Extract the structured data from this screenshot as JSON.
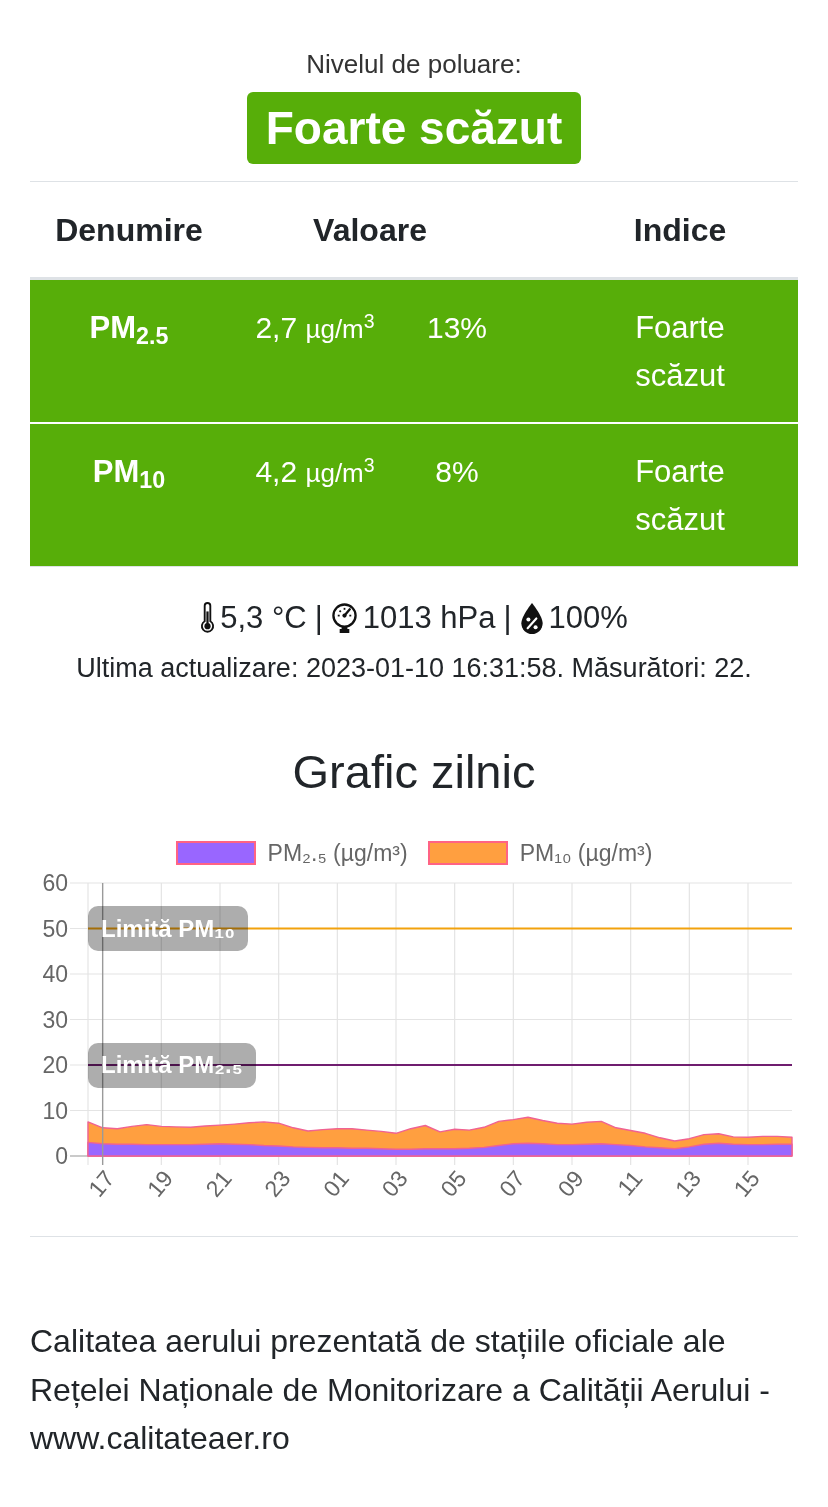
{
  "summary": {
    "label": "Nivelul de poluare:",
    "status": "Foarte scăzut"
  },
  "table": {
    "columns": [
      {
        "label": "Denumire"
      },
      {
        "label": "Valoare"
      },
      {
        "label": "Indice"
      }
    ],
    "rows": [
      {
        "name": "PM$_{2.5}$",
        "value": "2,7",
        "unit": "µg/m$^{3}$",
        "percent": "13%",
        "index": "Foarte scăzut"
      },
      {
        "name": "PM$_{10}$",
        "value": "4,2",
        "unit": "µg/m$^{3}$",
        "percent": "8%",
        "index": "Foarte scăzut"
      }
    ]
  },
  "weather": [
    {
      "kind": "temperature",
      "text": "5,3 °C"
    },
    {
      "kind": "separator",
      "text": "|"
    },
    {
      "kind": "pressure",
      "text": "1013 hPa"
    },
    {
      "kind": "separator",
      "text": "|"
    },
    {
      "kind": "humidity",
      "text": "100%"
    }
  ],
  "update_info": "Ultima actualizare: 2023-01-10 16:31:58. Măsurători: 22.",
  "chart": {
    "chart_data": {
      "type": "area",
      "title": "Grafic zilnic",
      "legend": "top",
      "grid": true,
      "x": [
        "2023-01-09T16:30",
        "2023-01-09T17:00",
        "2023-01-09T17:30",
        "2023-01-09T18:00",
        "2023-01-09T18:30",
        "2023-01-09T19:00",
        "2023-01-09T19:30",
        "2023-01-09T20:00",
        "2023-01-09T20:30",
        "2023-01-09T21:00",
        "2023-01-09T21:30",
        "2023-01-09T22:00",
        "2023-01-09T22:30",
        "2023-01-09T23:00",
        "2023-01-09T23:30",
        "2023-01-10T00:00",
        "2023-01-10T00:30",
        "2023-01-10T01:00",
        "2023-01-10T01:30",
        "2023-01-10T02:00",
        "2023-01-10T02:30",
        "2023-01-10T03:00",
        "2023-01-10T03:30",
        "2023-01-10T04:00",
        "2023-01-10T04:30",
        "2023-01-10T05:00",
        "2023-01-10T05:30",
        "2023-01-10T06:00",
        "2023-01-10T06:30",
        "2023-01-10T07:00",
        "2023-01-10T07:30",
        "2023-01-10T08:00",
        "2023-01-10T08:30",
        "2023-01-10T09:00",
        "2023-01-10T09:30",
        "2023-01-10T10:00",
        "2023-01-10T10:30",
        "2023-01-10T11:00",
        "2023-01-10T11:30",
        "2023-01-10T12:00",
        "2023-01-10T12:30",
        "2023-01-10T13:00",
        "2023-01-10T13:30",
        "2023-01-10T14:00",
        "2023-01-10T14:30",
        "2023-01-10T15:00",
        "2023-01-10T15:30",
        "2023-01-10T16:00",
        "2023-01-10T16:30"
      ],
      "series": [
        {
          "name": "PM₂.₅ (µg/m³)",
          "color": "#9966ff",
          "values": [
            3.0,
            2.7,
            2.6,
            2.6,
            2.5,
            2.5,
            2.5,
            2.5,
            2.6,
            2.7,
            2.6,
            2.5,
            2.3,
            2.2,
            2.0,
            1.9,
            1.8,
            1.8,
            1.7,
            1.7,
            1.6,
            1.5,
            1.5,
            1.6,
            1.6,
            1.6,
            1.7,
            1.9,
            2.3,
            2.7,
            2.8,
            2.7,
            2.5,
            2.5,
            2.6,
            2.7,
            2.5,
            2.3,
            2.0,
            1.8,
            1.6,
            2.0,
            2.6,
            2.8,
            2.6,
            2.5,
            2.5,
            2.6,
            2.6
          ]
        },
        {
          "name": "PM₁₀ (µg/m³)",
          "color": "#ff9f40",
          "values": [
            7.5,
            6.2,
            6.0,
            6.5,
            6.9,
            6.5,
            6.4,
            6.3,
            6.6,
            6.8,
            7.0,
            7.3,
            7.5,
            7.2,
            6.2,
            5.5,
            5.8,
            6.0,
            6.0,
            5.7,
            5.4,
            5.0,
            6.0,
            6.7,
            5.3,
            5.9,
            5.7,
            6.3,
            7.6,
            8.0,
            8.5,
            7.8,
            7.2,
            7.0,
            7.4,
            7.6,
            6.2,
            5.6,
            5.0,
            4.0,
            3.3,
            3.8,
            4.7,
            4.9,
            4.2,
            4.1,
            4.3,
            4.3,
            4.1
          ]
        }
      ],
      "xlim": [
        "2023-01-09T16:30",
        "2023-01-10T16:30"
      ],
      "ylim": [
        0,
        60
      ],
      "yticks": [
        0,
        10,
        20,
        30,
        40,
        50,
        60
      ],
      "xticks": [
        {
          "value": "2023-01-09T17:00",
          "label": "17"
        },
        {
          "value": "2023-01-09T19:00",
          "label": "19"
        },
        {
          "value": "2023-01-09T21:00",
          "label": "21"
        },
        {
          "value": "2023-01-09T23:00",
          "label": "23"
        },
        {
          "value": "2023-01-10T01:00",
          "label": "01"
        },
        {
          "value": "2023-01-10T03:00",
          "label": "03"
        },
        {
          "value": "2023-01-10T05:00",
          "label": "05"
        },
        {
          "value": "2023-01-10T07:00",
          "label": "07"
        },
        {
          "value": "2023-01-10T09:00",
          "label": "09"
        },
        {
          "value": "2023-01-10T11:00",
          "label": "11"
        },
        {
          "value": "2023-01-10T13:00",
          "label": "13"
        },
        {
          "value": "2023-01-10T15:00",
          "label": "15"
        }
      ],
      "ref_lines": [
        {
          "axis": "y",
          "value": 50,
          "color": "#f2a20d",
          "label": "Limită PM₁₀"
        },
        {
          "axis": "y",
          "value": 20,
          "color": "#6f1d6f",
          "label": "Limită PM₂.₅"
        },
        {
          "axis": "x",
          "value": "2023-01-09T17:00",
          "color": "#9a9a9a"
        }
      ]
    }
  },
  "footer": "Calitatea aerului prezentată de stațiile oficiale ale Rețelei Naționale de Monitorizare a Calității Aerului - www.calitateaer.ro"
}
